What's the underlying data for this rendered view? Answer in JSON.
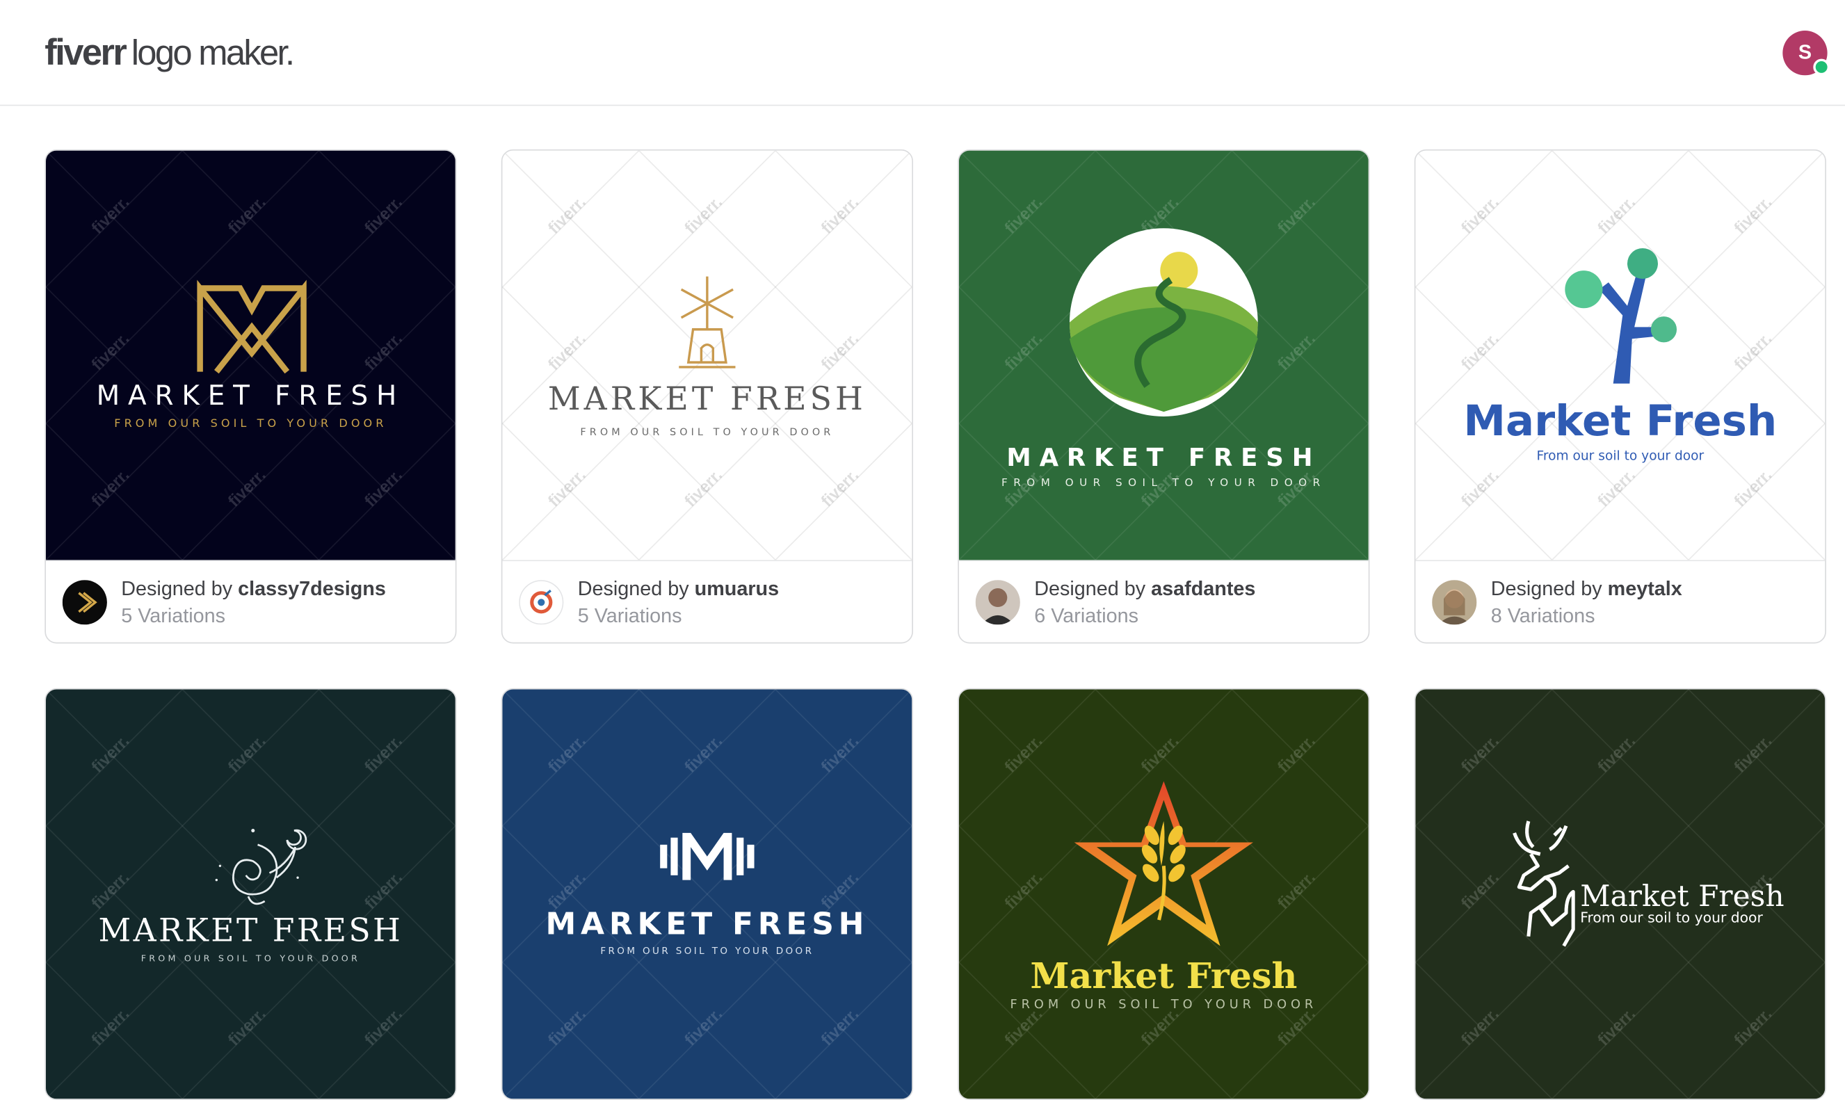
{
  "header": {
    "logo_brand": "fiverr",
    "logo_rest": "logo maker.",
    "avatar_initial": "S"
  },
  "watermark": "fiverr.",
  "designed_by_prefix": "Designed by ",
  "cards": [
    {
      "designer": "classy7designs",
      "variations": "5 Variations",
      "bg": "#03031c",
      "logo_title": "MARKET FRESH",
      "logo_tagline": "FROM OUR SOIL TO YOUR DOOR"
    },
    {
      "designer": "umuarus",
      "variations": "5 Variations",
      "bg": "#ffffff",
      "logo_title": "MARKET FRESH",
      "logo_tagline": "FROM OUR SOIL TO YOUR DOOR"
    },
    {
      "designer": "asafdantes",
      "variations": "6 Variations",
      "bg": "#2d6b3a",
      "logo_title": "MARKET FRESH",
      "logo_tagline": "FROM OUR SOIL TO YOUR DOOR"
    },
    {
      "designer": "meytalx",
      "variations": "8 Variations",
      "bg": "#ffffff",
      "logo_title": "Market Fresh",
      "logo_tagline": "From our soil to your door"
    },
    {
      "bg": "#13282a",
      "logo_title": "MARKET FRESH",
      "logo_tagline": "FROM OUR SOIL TO YOUR DOOR"
    },
    {
      "bg": "#1a3f6e",
      "logo_title": "MARKET FRESH",
      "logo_tagline": "FROM OUR SOIL TO YOUR DOOR"
    },
    {
      "bg": "#263a0f",
      "logo_title": "Market Fresh",
      "logo_tagline": "FROM OUR SOIL TO YOUR DOOR"
    },
    {
      "bg": "#222f1c",
      "logo_title": "Market Fresh",
      "logo_tagline": "From our soil to your door"
    }
  ]
}
